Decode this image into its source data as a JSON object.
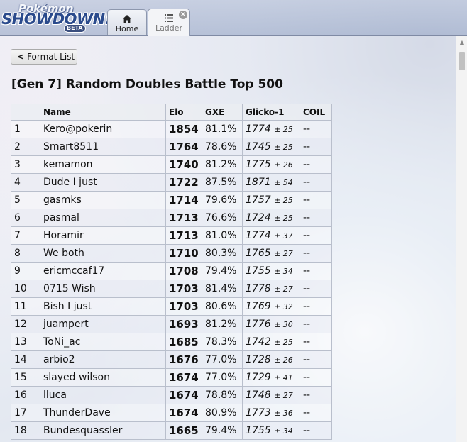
{
  "header": {
    "logo": {
      "line1": "Pokémon",
      "line2": "SHOWDOWN!",
      "badge": "BETA"
    },
    "tabs": [
      {
        "label": "Home",
        "icon": "home-icon"
      },
      {
        "label": "Ladder",
        "icon": "list-icon",
        "close_icon": "close-icon"
      }
    ]
  },
  "format_list_button": {
    "label": "Format List",
    "icon": "chevron-left-icon"
  },
  "page_title": "[Gen 7] Random Doubles Battle Top 500",
  "table": {
    "columns": [
      "",
      "Name",
      "Elo",
      "GXE",
      "Glicko-1",
      "COIL"
    ],
    "rows": [
      {
        "rank": "1",
        "name": "Kero@pokerin",
        "elo": "1854",
        "gxe": "81.1%",
        "glicko": "1774",
        "dev": "± 25",
        "coil": "--"
      },
      {
        "rank": "2",
        "name": "Smart8511",
        "elo": "1764",
        "gxe": "78.6%",
        "glicko": "1745",
        "dev": "± 25",
        "coil": "--"
      },
      {
        "rank": "3",
        "name": "kemamon",
        "elo": "1740",
        "gxe": "81.2%",
        "glicko": "1775",
        "dev": "± 26",
        "coil": "--"
      },
      {
        "rank": "4",
        "name": "Dude I just",
        "elo": "1722",
        "gxe": "87.5%",
        "glicko": "1871",
        "dev": "± 54",
        "coil": "--"
      },
      {
        "rank": "5",
        "name": "gasmks",
        "elo": "1714",
        "gxe": "79.6%",
        "glicko": "1757",
        "dev": "± 25",
        "coil": "--"
      },
      {
        "rank": "6",
        "name": "pasmal",
        "elo": "1713",
        "gxe": "76.6%",
        "glicko": "1724",
        "dev": "± 25",
        "coil": "--"
      },
      {
        "rank": "7",
        "name": "Horamir",
        "elo": "1713",
        "gxe": "81.0%",
        "glicko": "1774",
        "dev": "± 37",
        "coil": "--"
      },
      {
        "rank": "8",
        "name": "We both",
        "elo": "1710",
        "gxe": "80.3%",
        "glicko": "1765",
        "dev": "± 27",
        "coil": "--"
      },
      {
        "rank": "9",
        "name": "ericmccaf17",
        "elo": "1708",
        "gxe": "79.4%",
        "glicko": "1755",
        "dev": "± 34",
        "coil": "--"
      },
      {
        "rank": "10",
        "name": "0715 Wish",
        "elo": "1703",
        "gxe": "81.4%",
        "glicko": "1778",
        "dev": "± 27",
        "coil": "--"
      },
      {
        "rank": "11",
        "name": "Bish I just",
        "elo": "1703",
        "gxe": "80.6%",
        "glicko": "1769",
        "dev": "± 32",
        "coil": "--"
      },
      {
        "rank": "12",
        "name": "juampert",
        "elo": "1693",
        "gxe": "81.2%",
        "glicko": "1776",
        "dev": "± 30",
        "coil": "--"
      },
      {
        "rank": "13",
        "name": "ToNi_ac",
        "elo": "1685",
        "gxe": "78.3%",
        "glicko": "1742",
        "dev": "± 25",
        "coil": "--"
      },
      {
        "rank": "14",
        "name": "arbio2",
        "elo": "1676",
        "gxe": "77.0%",
        "glicko": "1728",
        "dev": "± 26",
        "coil": "--"
      },
      {
        "rank": "15",
        "name": "slayed wilson",
        "elo": "1674",
        "gxe": "77.0%",
        "glicko": "1729",
        "dev": "± 41",
        "coil": "--"
      },
      {
        "rank": "16",
        "name": "lluca",
        "elo": "1674",
        "gxe": "78.8%",
        "glicko": "1748",
        "dev": "± 27",
        "coil": "--"
      },
      {
        "rank": "17",
        "name": "ThunderDave",
        "elo": "1674",
        "gxe": "80.9%",
        "glicko": "1773",
        "dev": "± 36",
        "coil": "--"
      },
      {
        "rank": "18",
        "name": "Bundesquassler",
        "elo": "1665",
        "gxe": "79.4%",
        "glicko": "1755",
        "dev": "± 34",
        "coil": "--"
      }
    ]
  }
}
